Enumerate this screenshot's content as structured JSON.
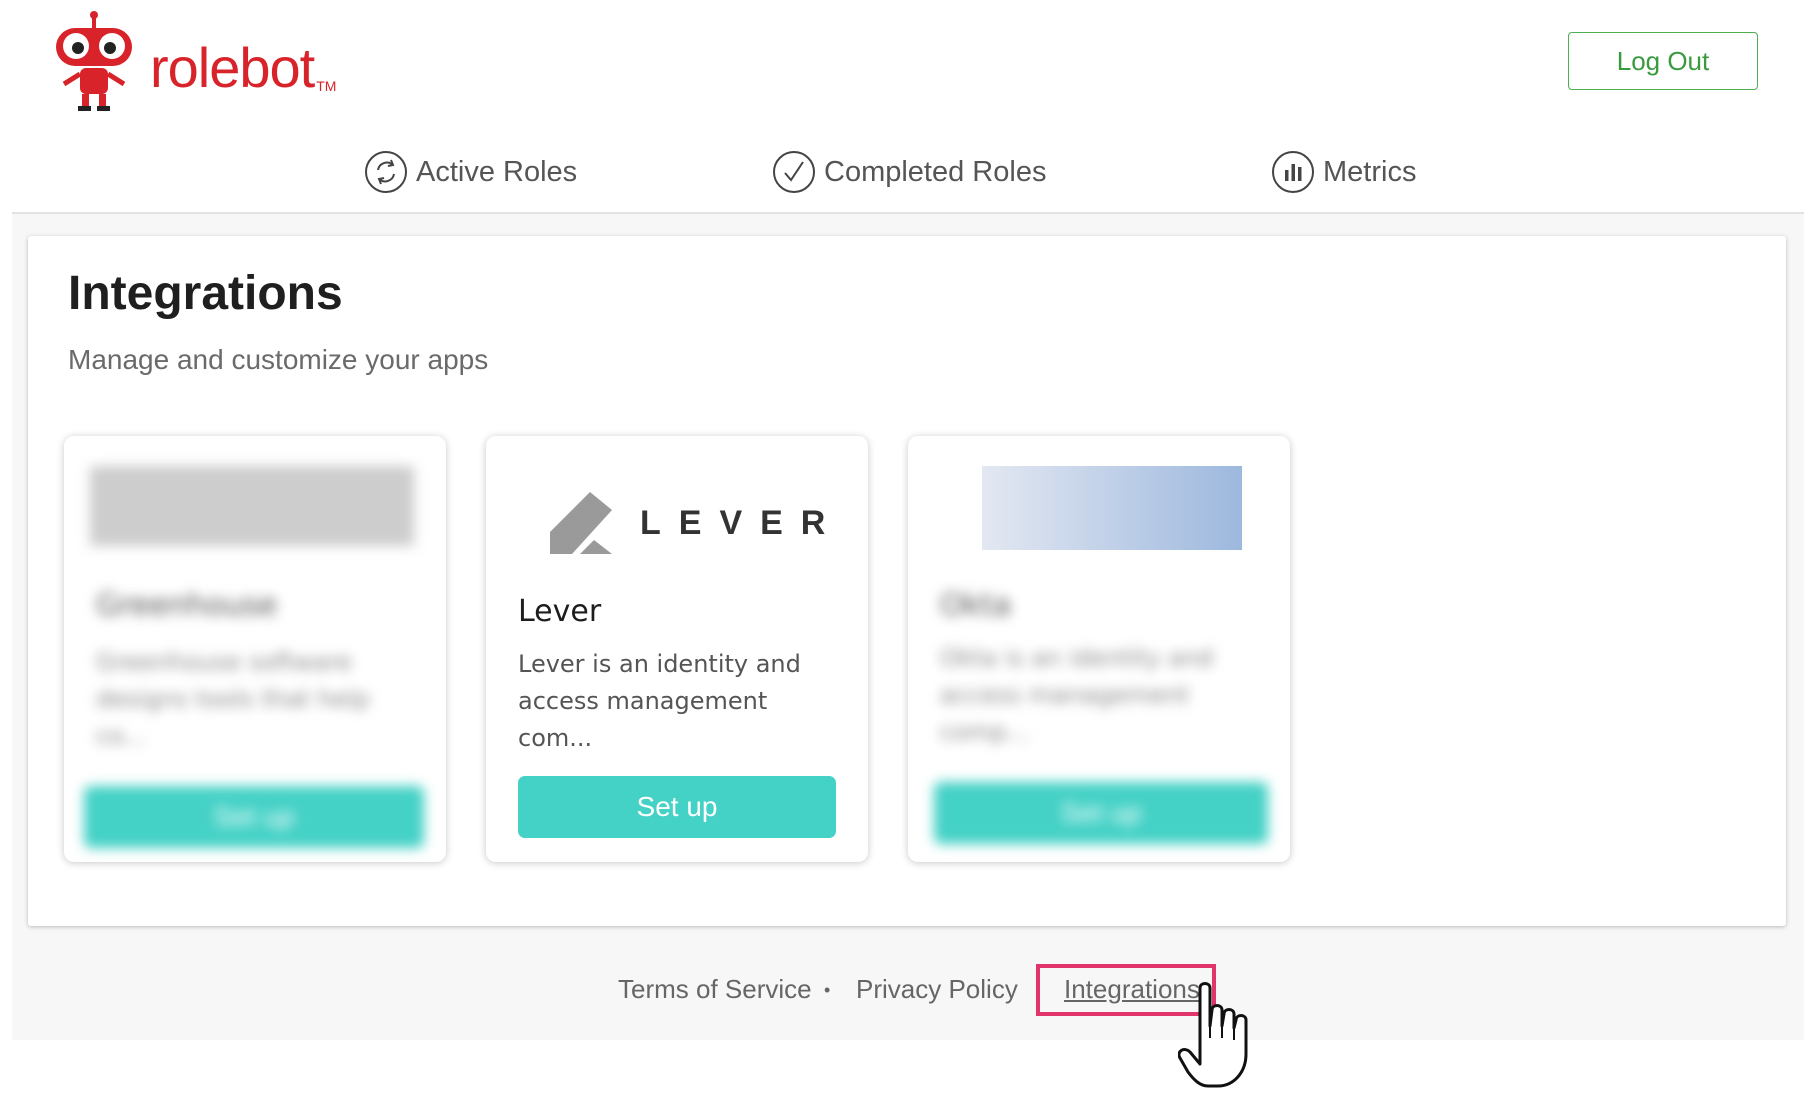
{
  "brand": {
    "name": "rolebot",
    "tm": "TM",
    "color": "#d8232a"
  },
  "header": {
    "logout_label": "Log Out"
  },
  "nav": [
    {
      "label": "Active Roles",
      "icon": "refresh-circle-icon"
    },
    {
      "label": "Completed Roles",
      "icon": "check-circle-icon"
    },
    {
      "label": "Metrics",
      "icon": "bar-chart-circle-icon"
    }
  ],
  "page": {
    "title": "Integrations",
    "subtitle": "Manage and customize your apps"
  },
  "cards": [
    {
      "name": "Greenhouse",
      "desc": "Greenhouse software designs tools that help co...",
      "button": "Set up",
      "blurred": true
    },
    {
      "name": "Lever",
      "logo_text": "LEVER",
      "desc": "Lever is an identity and access management com...",
      "button": "Set up",
      "blurred": false
    },
    {
      "name": "Okta",
      "desc": "Okta is an identity and access management comp...",
      "button": "Set up",
      "blurred": true
    }
  ],
  "footer": {
    "terms": "Terms of Service",
    "separator": "•",
    "privacy": "Privacy Policy",
    "integrations": "Integrations"
  },
  "colors": {
    "accent": "#44d1c6",
    "logout_border": "#4caf50",
    "highlight": "#e0356b"
  }
}
